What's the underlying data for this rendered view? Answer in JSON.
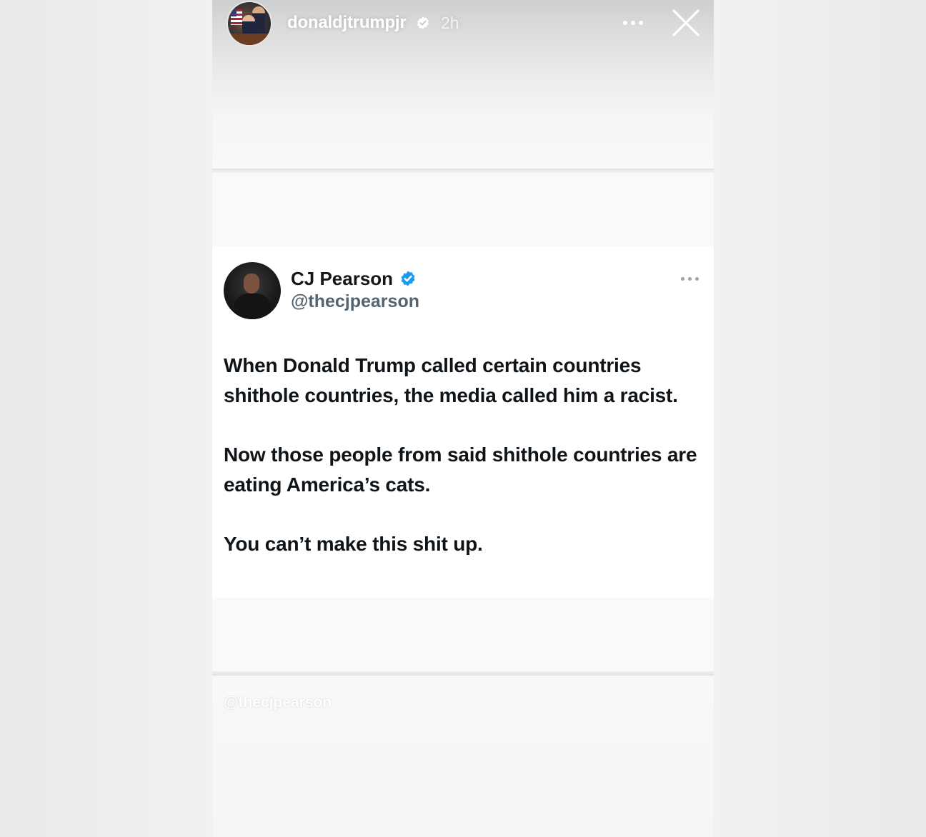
{
  "story": {
    "username": "donaldjtrumpjr",
    "time_ago": "2h",
    "mention_sticker": "@thecjpearson",
    "icons": {
      "verified": "verified-badge-icon",
      "more": "more-options-icon",
      "close": "close-icon"
    }
  },
  "tweet": {
    "display_name": "CJ Pearson",
    "handle": "@thecjpearson",
    "paragraphs": [
      "When Donald Trump called certain countries shithole countries, the media called him a racist.",
      "Now those people from said shithole countries are eating America’s cats.",
      "You can’t make this shit up."
    ],
    "icons": {
      "verified": "verified-badge-icon",
      "more": "more-options-icon"
    }
  },
  "colors": {
    "twitter_verified_blue": "#1d9bf0",
    "tweet_text": "#0f1419",
    "handle_gray": "#536471",
    "story_header_text": "#ffffff"
  }
}
